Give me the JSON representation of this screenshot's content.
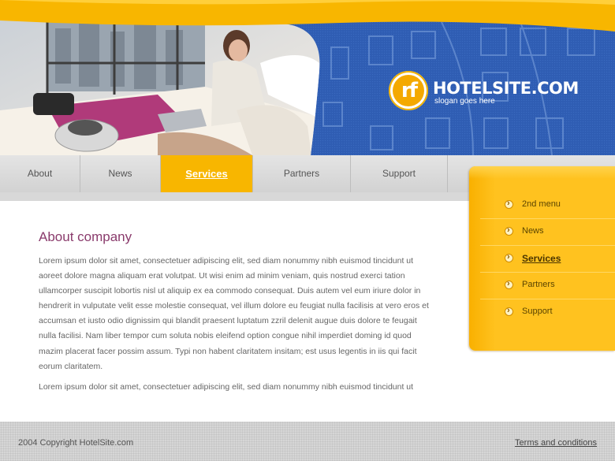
{
  "header": {
    "logo_mark": "rf",
    "logo_title": "HOTELSITE.COM",
    "logo_slogan": "slogan goes here"
  },
  "colors": {
    "accent_yellow": "#f8b600",
    "brand_blue": "#2e5bb0",
    "title_purple": "#8a3b6c"
  },
  "top_nav": {
    "items": [
      {
        "label": "About"
      },
      {
        "label": "News"
      },
      {
        "label": "Services",
        "active": true
      },
      {
        "label": "Partners"
      },
      {
        "label": "Support"
      }
    ]
  },
  "side_menu": {
    "items": [
      {
        "label": "2nd menu"
      },
      {
        "label": "News"
      },
      {
        "label": "Services",
        "active": true
      },
      {
        "label": "Partners"
      },
      {
        "label": "Support"
      }
    ]
  },
  "content": {
    "title": "About company",
    "paragraphs": [
      "Lorem ipsum dolor sit amet, consectetuer adipiscing elit, sed diam nonummy nibh euismod tincidunt ut aoreet dolore magna aliquam erat volutpat. Ut wisi enim ad minim veniam, quis nostrud exerci tation ullamcorper suscipit lobortis nisl ut aliquip ex ea commodo consequat. Duis autem vel eum iriure dolor in hendrerit in vulputate velit esse molestie consequat, vel illum dolore eu feugiat nulla facilisis at vero eros et accumsan et iusto odio dignissim qui blandit praesent luptatum zzril delenit augue duis dolore te feugait nulla facilisi. Nam liber tempor cum soluta nobis eleifend option congue nihil imperdiet doming id quod mazim placerat facer possim assum. Typi non habent claritatem insitam; est usus legentis in iis qui facit eorum claritatem.",
      "Lorem ipsum dolor sit amet, consectetuer adipiscing elit, sed diam nonummy nibh euismod tincidunt ut"
    ]
  },
  "footer": {
    "copyright": "2004 Copyright HotelSite.com",
    "terms": "Terms and conditions"
  }
}
